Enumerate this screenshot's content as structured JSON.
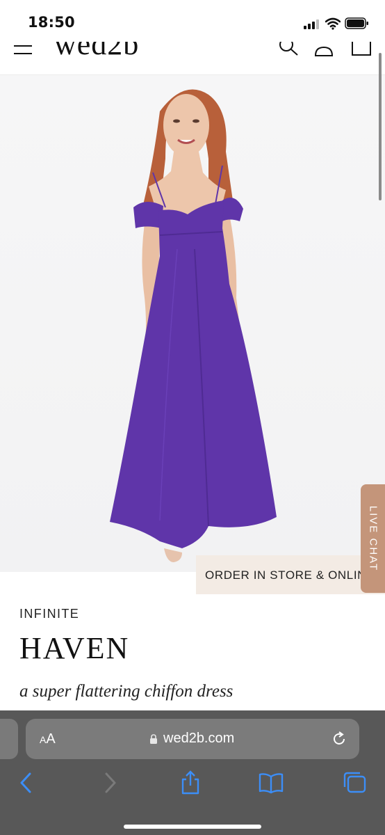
{
  "status_bar": {
    "time": "18:50"
  },
  "site": {
    "logo": "wed2b"
  },
  "product": {
    "badge": "ORDER IN STORE & ONLINE",
    "live_chat": "LIVE CHAT",
    "collection": "INFINITE",
    "name": "HAVEN",
    "tagline": "a super flattering chiffon dress",
    "dress_color": "#5f35a9"
  },
  "browser": {
    "text_size_label_small": "A",
    "text_size_label_large": "A",
    "url": "wed2b.com"
  },
  "icons": {
    "menu": "hamburger-menu-icon",
    "search": "search-icon",
    "account": "account-icon",
    "bag": "shopping-bag-icon",
    "lock": "lock-icon",
    "reload": "reload-icon",
    "back": "chevron-left-icon",
    "forward": "chevron-right-icon",
    "share": "share-icon",
    "bookmarks": "book-icon",
    "tabs": "tabs-icon"
  }
}
